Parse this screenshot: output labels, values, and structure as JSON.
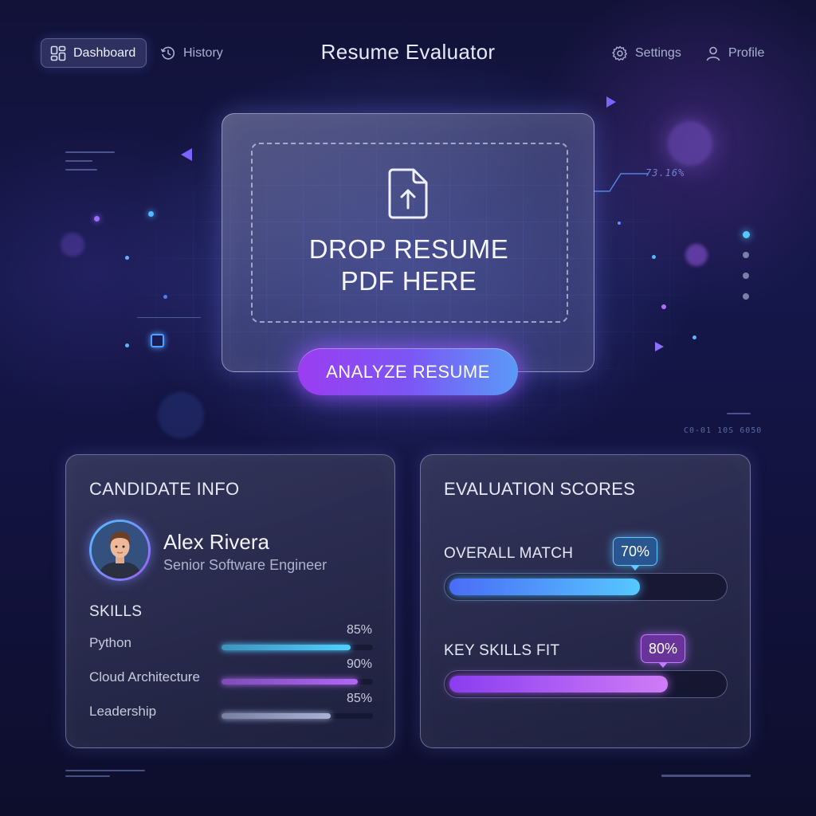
{
  "nav": {
    "dashboard_label": "Dashboard",
    "history_label": "History",
    "settings_label": "Settings",
    "profile_label": "Profile",
    "active_tab": "Dashboard"
  },
  "app": {
    "title": "Resume Evaluator"
  },
  "upload": {
    "drop_text": "DROP RESUME\nPDF HERE",
    "analyze_button": "ANALYZE RESUME"
  },
  "decor": {
    "readout_1": "73.16%",
    "readout_2": "C0-01 10S 6050"
  },
  "candidate": {
    "section_title": "CANDIDATE INFO",
    "name": "Alex Rivera",
    "role": "Senior Software Engineer",
    "skills_title": "SKILLS",
    "skills": [
      {
        "name": "Python",
        "percent_label": "85%",
        "value": 0.85,
        "color": "#4fd0ff"
      },
      {
        "name": "Cloud Architecture",
        "percent_label": "90%",
        "value": 0.9,
        "color": "#b067f5"
      },
      {
        "name": "Leadership",
        "percent_label": "85%",
        "value": 0.72,
        "color": "#a9b2d6"
      }
    ]
  },
  "scores": {
    "section_title": "EVALUATION SCORES",
    "items": [
      {
        "label": "OVERALL MATCH",
        "percent_label": "70%",
        "value": 0.7,
        "style": "blue"
      },
      {
        "label": "KEY SKILLS FIT",
        "percent_label": "80%",
        "value": 0.8,
        "style": "purple"
      }
    ]
  },
  "colors": {
    "accent_blue": "#4fc3ff",
    "accent_purple": "#9d5cf5",
    "background": "#131340"
  }
}
